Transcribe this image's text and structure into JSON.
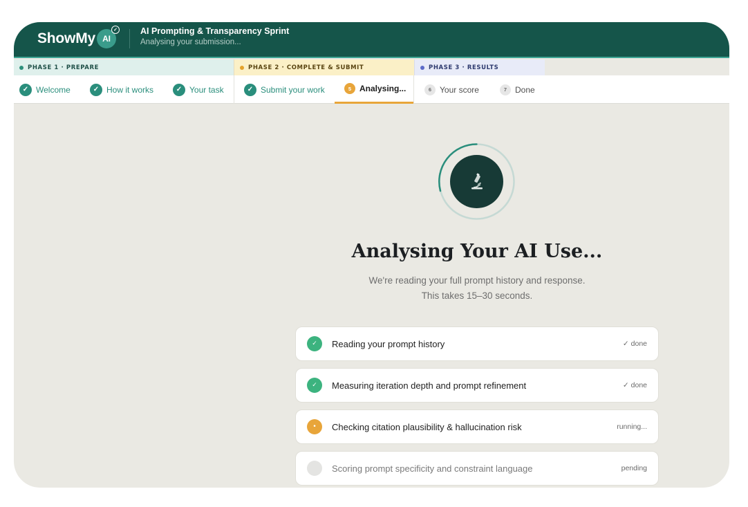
{
  "header": {
    "logo_text": "ShowMy",
    "logo_badge": "AI",
    "title": "AI Prompting & Transparency Sprint",
    "subtitle": "Analysing your submission..."
  },
  "phases": [
    {
      "label": "Phase 1 · Prepare"
    },
    {
      "label": "Phase 2 · Complete & Submit"
    },
    {
      "label": "Phase 3 · Results"
    }
  ],
  "steps": [
    {
      "num": "✓",
      "label": "Welcome",
      "state": "done"
    },
    {
      "num": "✓",
      "label": "How it works",
      "state": "done"
    },
    {
      "num": "✓",
      "label": "Your task",
      "state": "done"
    },
    {
      "num": "✓",
      "label": "Submit your work",
      "state": "done"
    },
    {
      "num": "5",
      "label": "Analysing...",
      "state": "active"
    },
    {
      "num": "6",
      "label": "Your score",
      "state": "todo"
    },
    {
      "num": "7",
      "label": "Done",
      "state": "todo"
    }
  ],
  "main": {
    "spinner_icon": "microscope-icon",
    "title": "Analysing Your AI Use...",
    "subtitle_line1": "We're reading your full prompt history and response.",
    "subtitle_line2": "This takes 15–30 seconds."
  },
  "checklist": [
    {
      "label": "Reading your prompt history",
      "status": "✓ done",
      "state": "done"
    },
    {
      "label": "Measuring iteration depth and prompt refinement",
      "status": "✓ done",
      "state": "done"
    },
    {
      "label": "Checking citation plausibility & hallucination risk",
      "status": "running...",
      "state": "running"
    },
    {
      "label": "Scoring prompt specificity and constraint language",
      "status": "pending",
      "state": "pending"
    }
  ],
  "colors": {
    "header_bg": "#15554a",
    "accent_teal": "#2a8e7c",
    "accent_orange": "#e8a53a",
    "done_green": "#3cb37f",
    "canvas_bg": "#eae9e3"
  }
}
